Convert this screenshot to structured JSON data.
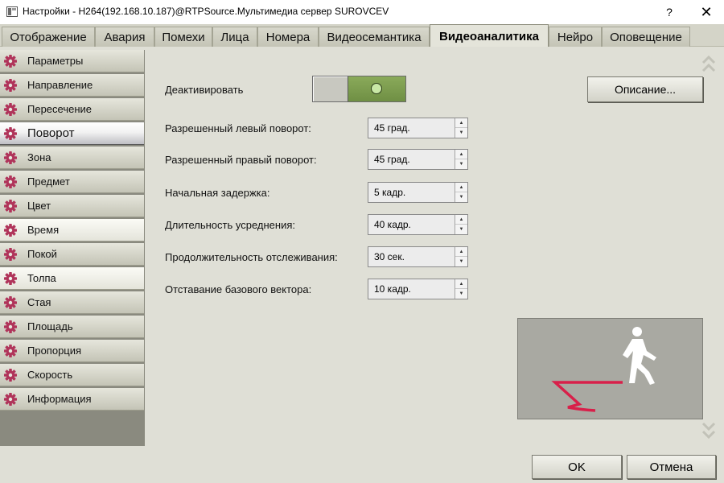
{
  "window": {
    "title": "Настройки - H264(192.168.10.187)@RTPSource.Мультимедиа сервер SUROVCEV",
    "help": "?",
    "close": "✕"
  },
  "tabs": [
    {
      "label": "Отображение"
    },
    {
      "label": "Авария"
    },
    {
      "label": "Помехи"
    },
    {
      "label": "Лица"
    },
    {
      "label": "Номера"
    },
    {
      "label": "Видеосемантика"
    },
    {
      "label": "Видеоаналитика"
    },
    {
      "label": "Нейро"
    },
    {
      "label": "Оповещение"
    }
  ],
  "active_tab": "Видеоаналитика",
  "sidebar": {
    "items": [
      {
        "label": "Параметры"
      },
      {
        "label": "Направление"
      },
      {
        "label": "Пересечение"
      },
      {
        "label": "Поворот"
      },
      {
        "label": "Зона"
      },
      {
        "label": "Предмет"
      },
      {
        "label": "Цвет"
      },
      {
        "label": "Время"
      },
      {
        "label": "Покой"
      },
      {
        "label": "Толпа"
      },
      {
        "label": "Стая"
      },
      {
        "label": "Площадь"
      },
      {
        "label": "Пропорция"
      },
      {
        "label": "Скорость"
      },
      {
        "label": "Информация"
      }
    ],
    "active": "Поворот"
  },
  "form": {
    "deactivate_label": "Деактивировать",
    "description_button": "Описание...",
    "fields": [
      {
        "label": "Разрешенный левый поворот:",
        "value": "45 град."
      },
      {
        "label": "Разрешенный правый поворот:",
        "value": "45 град."
      },
      {
        "label": "Начальная задержка:",
        "value": "5 кадр."
      },
      {
        "label": "Длительность усреднения:",
        "value": "40 кадр."
      },
      {
        "label": "Продолжительность отслеживания:",
        "value": "30 сек."
      },
      {
        "label": "Отставание базового вектора:",
        "value": "10 кадр."
      }
    ]
  },
  "buttons": {
    "ok": "OK",
    "cancel": "Отмена"
  },
  "colors": {
    "accent_gear": "#b0345a",
    "toggle_on": "#7a9a4e",
    "turn_arrow": "#d8204a"
  },
  "icons": {
    "sidebar_item": "gear-icon",
    "preview": "pedestrian-icon"
  }
}
